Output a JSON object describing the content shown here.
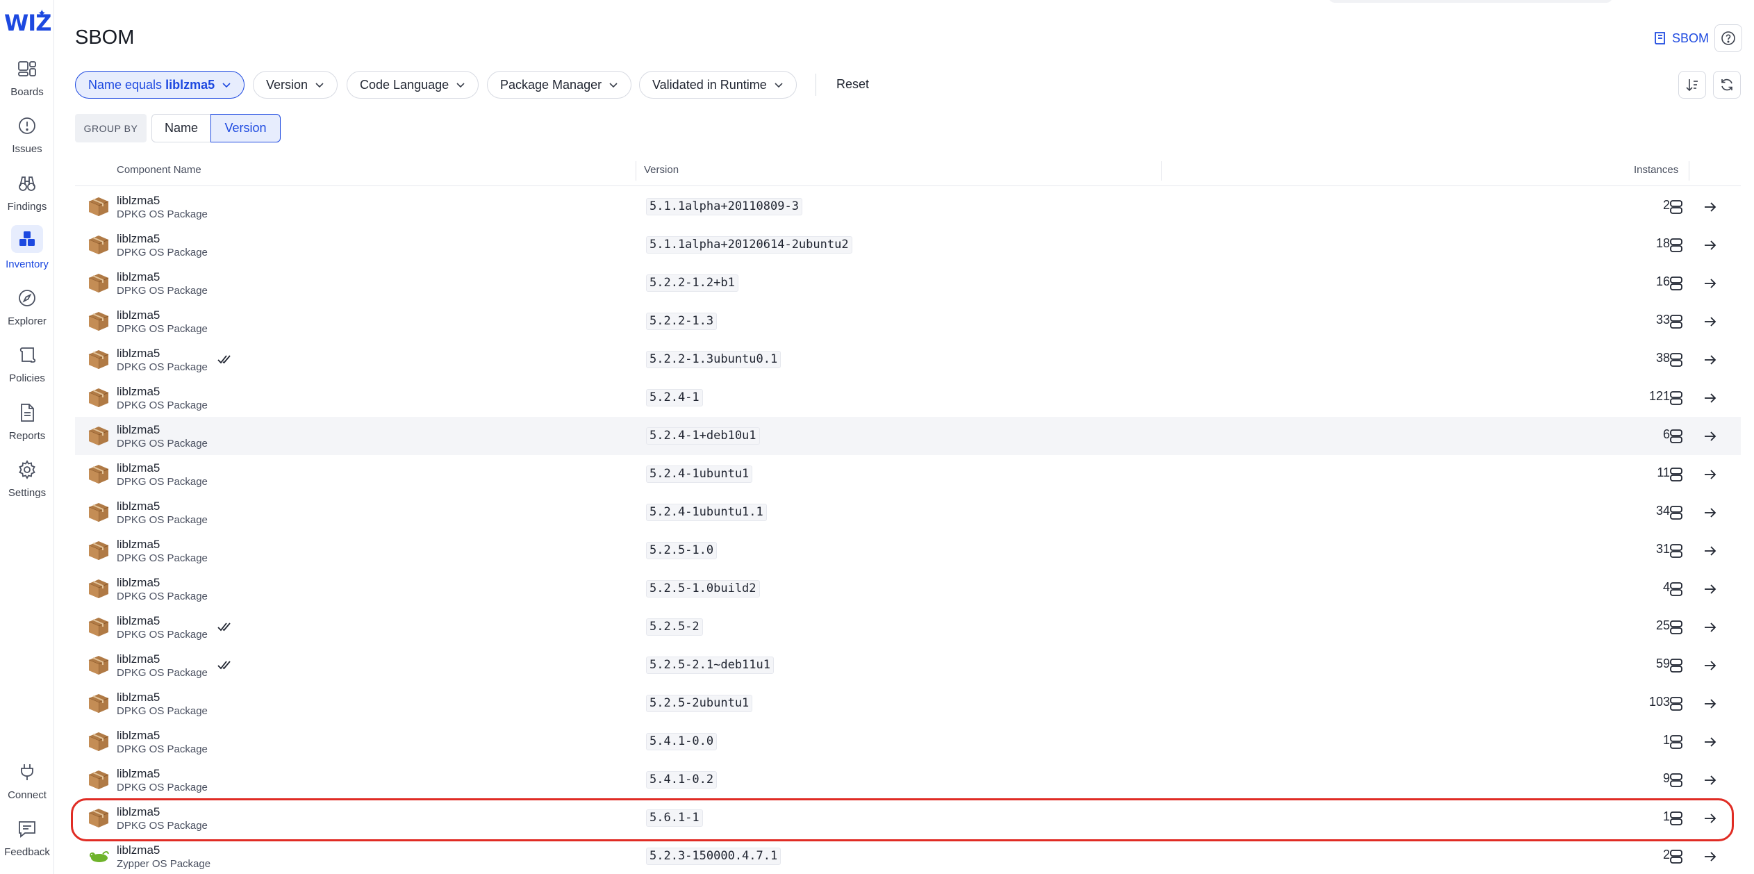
{
  "app": {
    "logo": "WIZ",
    "page_title": "SBOM"
  },
  "sidebar": {
    "top_items": [
      {
        "label": "Boards",
        "icon": "boards-icon"
      },
      {
        "label": "Issues",
        "icon": "issues-icon"
      },
      {
        "label": "Findings",
        "icon": "binoculars-icon"
      },
      {
        "label": "Inventory",
        "icon": "inventory-icon",
        "active": true
      },
      {
        "label": "Explorer",
        "icon": "compass-icon"
      },
      {
        "label": "Policies",
        "icon": "scroll-icon"
      },
      {
        "label": "Reports",
        "icon": "document-icon"
      },
      {
        "label": "Settings",
        "icon": "gear-icon"
      }
    ],
    "bottom_items": [
      {
        "label": "Connect",
        "icon": "plug-icon"
      },
      {
        "label": "Feedback",
        "icon": "chat-icon"
      }
    ]
  },
  "header": {
    "sbom_link": "SBOM",
    "help_icon": "help-icon"
  },
  "filters": {
    "name_prefix": "Name equals",
    "name_value": "liblzma5",
    "version": "Version",
    "code_language": "Code Language",
    "package_manager": "Package Manager",
    "validated_runtime": "Validated in Runtime",
    "reset": "Reset"
  },
  "group_by": {
    "label": "GROUP BY",
    "options": [
      "Name",
      "Version"
    ],
    "selected": "Version"
  },
  "table": {
    "columns": {
      "component": "Component Name",
      "version": "Version",
      "instances": "Instances"
    },
    "rows": [
      {
        "name": "liblzma5",
        "type": "DPKG OS Package",
        "version": "5.1.1alpha+20110809-3",
        "instances": "2",
        "validated": false
      },
      {
        "name": "liblzma5",
        "type": "DPKG OS Package",
        "version": "5.1.1alpha+20120614-2ubuntu2",
        "instances": "18",
        "validated": false
      },
      {
        "name": "liblzma5",
        "type": "DPKG OS Package",
        "version": "5.2.2-1.2+b1",
        "instances": "16",
        "validated": false
      },
      {
        "name": "liblzma5",
        "type": "DPKG OS Package",
        "version": "5.2.2-1.3",
        "instances": "33",
        "validated": false
      },
      {
        "name": "liblzma5",
        "type": "DPKG OS Package",
        "version": "5.2.2-1.3ubuntu0.1",
        "instances": "38",
        "validated": true
      },
      {
        "name": "liblzma5",
        "type": "DPKG OS Package",
        "version": "5.2.4-1",
        "instances": "121",
        "validated": false
      },
      {
        "name": "liblzma5",
        "type": "DPKG OS Package",
        "version": "5.2.4-1+deb10u1",
        "instances": "6",
        "validated": false
      },
      {
        "name": "liblzma5",
        "type": "DPKG OS Package",
        "version": "5.2.4-1ubuntu1",
        "instances": "11",
        "validated": false
      },
      {
        "name": "liblzma5",
        "type": "DPKG OS Package",
        "version": "5.2.4-1ubuntu1.1",
        "instances": "34",
        "validated": false
      },
      {
        "name": "liblzma5",
        "type": "DPKG OS Package",
        "version": "5.2.5-1.0",
        "instances": "31",
        "validated": false
      },
      {
        "name": "liblzma5",
        "type": "DPKG OS Package",
        "version": "5.2.5-1.0build2",
        "instances": "4",
        "validated": false
      },
      {
        "name": "liblzma5",
        "type": "DPKG OS Package",
        "version": "5.2.5-2",
        "instances": "25",
        "validated": true
      },
      {
        "name": "liblzma5",
        "type": "DPKG OS Package",
        "version": "5.2.5-2.1~deb11u1",
        "instances": "59",
        "validated": true
      },
      {
        "name": "liblzma5",
        "type": "DPKG OS Package",
        "version": "5.2.5-2ubuntu1",
        "instances": "103",
        "validated": false
      },
      {
        "name": "liblzma5",
        "type": "DPKG OS Package",
        "version": "5.4.1-0.0",
        "instances": "1",
        "validated": false
      },
      {
        "name": "liblzma5",
        "type": "DPKG OS Package",
        "version": "5.4.1-0.2",
        "instances": "9",
        "validated": false
      },
      {
        "name": "liblzma5",
        "type": "DPKG OS Package",
        "version": "5.6.1-1",
        "instances": "1",
        "validated": false,
        "highlighted": true
      },
      {
        "name": "liblzma5",
        "type": "Zypper OS Package",
        "version": "5.2.3-150000.4.7.1",
        "instances": "2",
        "validated": false,
        "zypper": true
      }
    ]
  },
  "colors": {
    "accent": "#1d49e0",
    "highlight": "#e02c24",
    "package": "#b07a45",
    "zypper": "#6fb32b"
  }
}
